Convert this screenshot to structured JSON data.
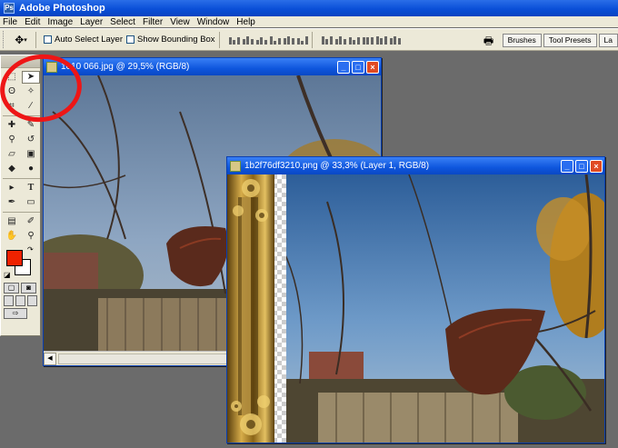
{
  "app": {
    "title": "Adobe Photoshop"
  },
  "menu": [
    "File",
    "Edit",
    "Image",
    "Layer",
    "Select",
    "Filter",
    "View",
    "Window",
    "Help"
  ],
  "options_bar": {
    "auto_select_layer": "Auto Select Layer",
    "show_bounding_box": "Show Bounding Box",
    "palette_tabs": [
      "Brushes",
      "Tool Presets",
      "La"
    ]
  },
  "toolbox": {
    "tools": [
      "marquee-icon",
      "move-icon",
      "lasso-icon",
      "magic-wand-icon",
      "crop-icon",
      "slice-icon",
      "healing-brush-icon",
      "brush-icon",
      "clone-stamp-icon",
      "history-brush-icon",
      "eraser-icon",
      "gradient-icon",
      "blur-icon",
      "dodge-icon",
      "path-selection-icon",
      "type-icon",
      "pen-icon",
      "shape-icon",
      "notes-icon",
      "eyedropper-icon",
      "hand-icon",
      "zoom-icon"
    ],
    "foreground_color": "#ee2200",
    "background_color": "#ffffff"
  },
  "documents": [
    {
      "title": "1010 066.jpg @ 29,5% (RGB/8)"
    },
    {
      "title": "1b2f76df3210.png @ 33,3% (Layer 1, RGB/8)"
    }
  ],
  "annotation_color": "#ee1616"
}
